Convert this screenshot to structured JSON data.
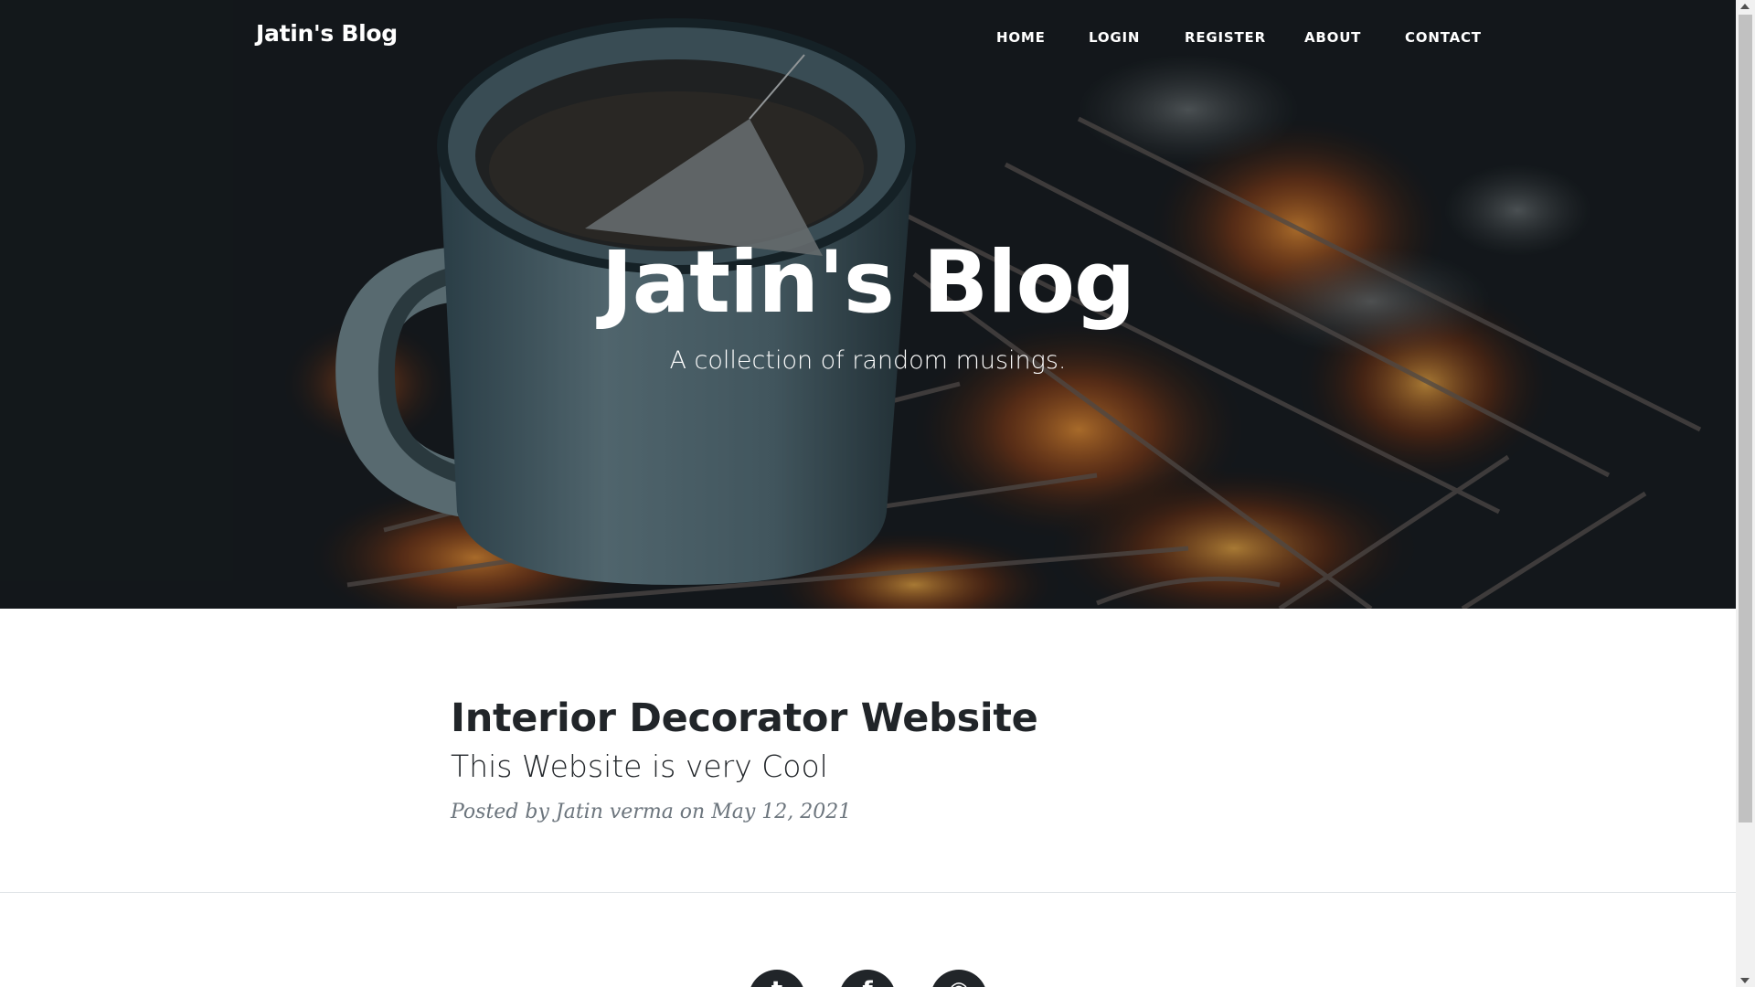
{
  "navbar": {
    "brand": "Jatin's Blog",
    "links": [
      "HOME",
      "LOGIN",
      "REGISTER",
      "ABOUT",
      "CONTACT"
    ]
  },
  "hero": {
    "title": "Jatin's Blog",
    "subtitle": "A collection of random musings."
  },
  "posts": [
    {
      "title": "Interior Decorator Website",
      "subtitle": "This Website is very Cool",
      "meta": "Posted by Jatin verma on May 12, 2021"
    }
  ],
  "footer": {
    "social_icons": [
      "twitter-icon",
      "facebook-icon",
      "github-icon"
    ]
  },
  "colors": {
    "text_dark": "#212529",
    "text_muted": "#6c757d",
    "divider": "#dee2e6",
    "social_bg": "#212529"
  }
}
